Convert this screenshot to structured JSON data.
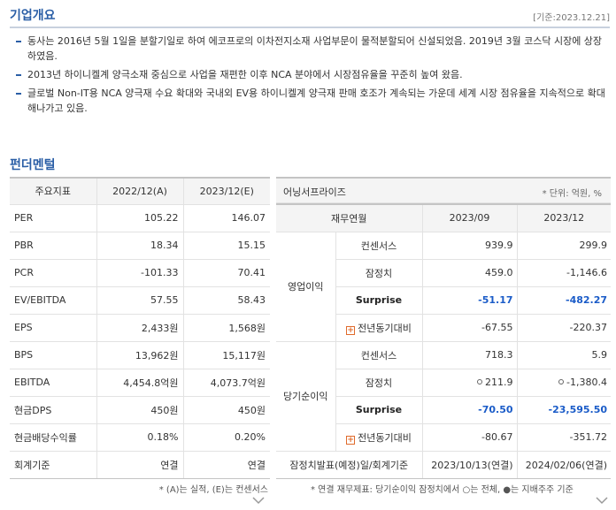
{
  "overview": {
    "title": "기업개요",
    "base_date": "[기준:2023.12.21]",
    "bullets": [
      "동사는 2016년 5월 1일을 분할기일로 하여 에코프로의 이차전지소재 사업부문이 물적분할되어 신설되었음. 2019년 3월 코스닥 시장에 상장하였음.",
      "2013년 하이니켈계 양극소재 중심으로 사업을 재편한 이후 NCA 분야에서 시장점유율을 꾸준히 높여 왔음.",
      "글로벌 Non-IT용 NCA 양극재 수요 확대와 국내외 EV용 하이니켈계 양극재 판매 호조가 계속되는 가운데 세계 시장 점유율을 지속적으로 확대해나가고 있음."
    ]
  },
  "fundamental": {
    "title": "펀더멘털",
    "headers": [
      "주요지표",
      "2022/12(A)",
      "2023/12(E)"
    ],
    "rows": [
      {
        "label": "PER",
        "a": "105.22",
        "e": "146.07"
      },
      {
        "label": "PBR",
        "a": "18.34",
        "e": "15.15"
      },
      {
        "label": "PCR",
        "a": "-101.33",
        "e": "70.41"
      },
      {
        "label": "EV/EBITDA",
        "a": "57.55",
        "e": "58.43"
      },
      {
        "label": "EPS",
        "a": "2,433원",
        "e": "1,568원"
      },
      {
        "label": "BPS",
        "a": "13,962원",
        "e": "15,117원"
      },
      {
        "label": "EBITDA",
        "a": "4,454.8억원",
        "e": "4,073.7억원"
      },
      {
        "label": "현금DPS",
        "a": "450원",
        "e": "450원"
      },
      {
        "label": "현금배당수익률",
        "a": "0.18%",
        "e": "0.20%"
      },
      {
        "label": "회계기준",
        "a": "연결",
        "e": "연결"
      }
    ],
    "note": "* (A)는 실적, (E)는 컨센서스"
  },
  "earnings": {
    "title": "어닝서프라이즈",
    "unit": "* 단위: 억원, %",
    "headers": [
      "재무연월",
      "2023/09",
      "2023/12"
    ],
    "groups": [
      {
        "name": "영업이익",
        "rows": [
          {
            "label": "컨센서스",
            "v1": "939.9",
            "v2": "299.9"
          },
          {
            "label": "잠정치",
            "v1": "459.0",
            "v2": "-1,146.6"
          },
          {
            "label": "Surprise",
            "v1": "-51.17",
            "v2": "-482.27"
          },
          {
            "label": "전년동기대비",
            "v1": "-67.55",
            "v2": "-220.37"
          }
        ]
      },
      {
        "name": "당기순이익",
        "rows": [
          {
            "label": "컨센서스",
            "v1": "718.3",
            "v2": "5.9"
          },
          {
            "label": "잠정치",
            "v1": "211.9",
            "v2": "-1,380.4"
          },
          {
            "label": "Surprise",
            "v1": "-70.50",
            "v2": "-23,595.50"
          },
          {
            "label": "전년동기대비",
            "v1": "-80.67",
            "v2": "-351.72"
          }
        ]
      }
    ],
    "footer_row": {
      "label": "잠정치발표(예정)일/회계기준",
      "v1": "2023/10/13(연결)",
      "v2": "2024/02/06(연결)"
    },
    "note": "* 연결 재무제표: 당기순이익 잠정치에서 ○는 전체, ●는 지배주주 기준"
  },
  "colors": {
    "accent": "#2a5ea6",
    "surprise_blue": "#1b5cc8",
    "plus_orange": "#e06b2c"
  },
  "icons": [
    "plus-box-icon",
    "circle-icon",
    "chevron-down-icon"
  ]
}
